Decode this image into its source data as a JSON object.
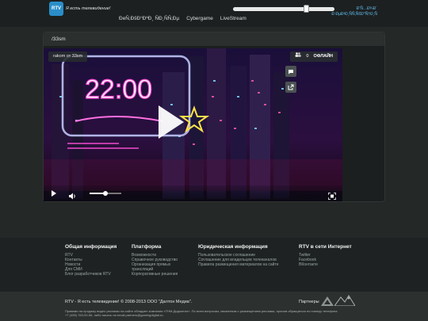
{
  "header": {
    "logo_text": "RTV",
    "slogan": "Я есть телевидение!",
    "nav": [
      "ÐeÑ‚ÐšÐ°ÐºÐ¸ ÑÐ¸ÑÑ‚Ðµ",
      "Cybergame",
      "LiveStream"
    ],
    "user_links": [
      "Ð’Ñ…Ð¾Ð´",
      "Ð ÐµÐ³Ð¸ÑÑ‚Ñ€Ð°Ñ†Ð¸Ñ"
    ],
    "slider_level": 0.72
  },
  "channel": {
    "title": "/33sm",
    "author": "rakom от 33sm",
    "viewers": "0",
    "status": "ОФЛАЙН",
    "overlay_clock": "22:00",
    "volume_level": 0.5
  },
  "footer": {
    "columns": [
      {
        "title": "Общая информация",
        "items": [
          "RTV",
          "Контакты",
          "Новости",
          "Для СМИ",
          "Блог разработчиков RTV"
        ]
      },
      {
        "title": "Платформа",
        "items": [
          "Возможности",
          "Справочное руководство",
          "Организация прямых",
          "трансляций",
          "Корпоративные решения"
        ]
      },
      {
        "title": "Юридическая информация",
        "items": [
          "Пользовательское соглашение",
          "Соглашение для владельцев телеканалов",
          "Правила размещения материалов на сайте"
        ]
      },
      {
        "title": "RTV в сети Интернет",
        "items": [
          "Twitter",
          "Facebook",
          "ВКонтакте"
        ]
      }
    ],
    "copyright": "RTV - Я есть телевидение! © 2008-2013 ООО \"Далтон Медиа\".",
    "fine_print_1": "Правами на продажу видео рекламы на сайте обладает компания «ТНМ-Диджитал». По всем вопросам, связанным с размещением рекламы, просим обращаться по номеру телефона",
    "fine_print_2": "+7 (495) 783-00-56, либо писать на email partners@gamingdigital.ru.",
    "partners_label": "Партнеры"
  },
  "colors": {
    "accent": "#2a8ec9",
    "background": "#242827",
    "neon_pink": "#ff4fd8",
    "neon_blue": "#5fd0ff"
  }
}
